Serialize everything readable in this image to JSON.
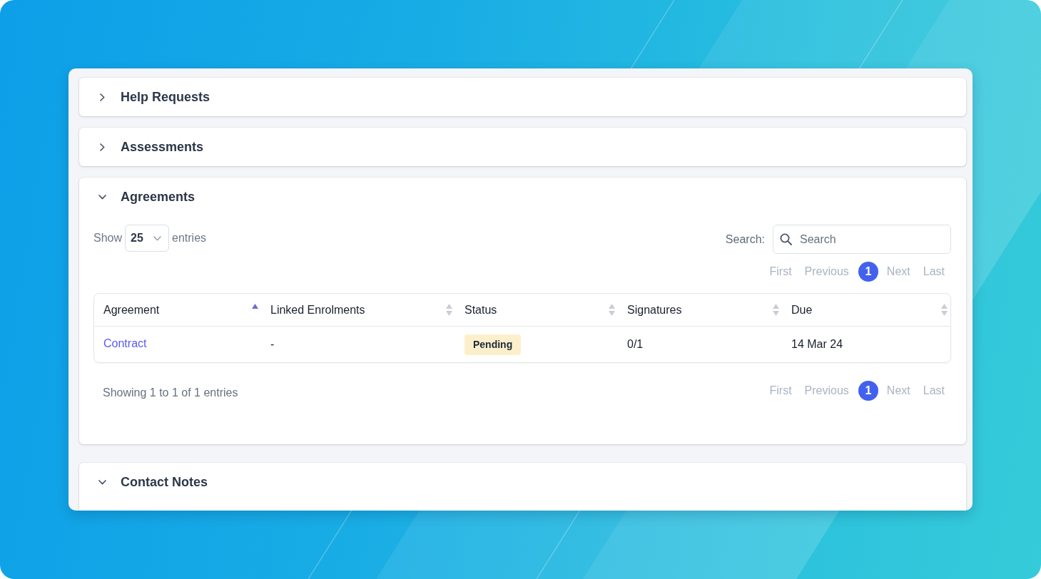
{
  "sections": [
    {
      "title": "Help Requests",
      "expanded": false
    },
    {
      "title": "Assessments",
      "expanded": false
    },
    {
      "title": "Agreements",
      "expanded": true,
      "table": {
        "length_menu": {
          "label": "Show",
          "value": "25",
          "suffix": "entries"
        },
        "search": {
          "label": "Search:",
          "placeholder": "Search"
        },
        "pagination_top": [
          {
            "label": "First",
            "selected": false,
            "disabled": true
          },
          {
            "label": "Previous",
            "selected": false,
            "disabled": true
          },
          {
            "label": "1",
            "selected": true,
            "disabled": false
          },
          {
            "label": "Next",
            "selected": false,
            "disabled": true
          },
          {
            "label": "Last",
            "selected": false,
            "disabled": true
          }
        ],
        "columns": [
          {
            "label": "Agreement",
            "sorted": true
          },
          {
            "label": "Linked Enrolments",
            "sorted": false
          },
          {
            "label": "Status",
            "sorted": false
          },
          {
            "label": "Signatures",
            "sorted": false
          },
          {
            "label": "Due",
            "sorted": false
          }
        ],
        "rows": [
          {
            "cells": [
              {
                "kind": "link",
                "text": "Contract"
              },
              {
                "kind": "text",
                "text": "-"
              },
              {
                "kind": "badge",
                "text": "Pending"
              },
              {
                "kind": "text",
                "text": "0/1"
              },
              {
                "kind": "text",
                "text": "14 Mar 24"
              }
            ]
          }
        ],
        "info": "Showing 1 to 1 of 1 entries",
        "pagination_bottom": [
          {
            "label": "First",
            "selected": false,
            "disabled": true
          },
          {
            "label": "Previous",
            "selected": false,
            "disabled": true
          },
          {
            "label": "1",
            "selected": true,
            "disabled": false
          },
          {
            "label": "Next",
            "selected": false,
            "disabled": true
          },
          {
            "label": "Last",
            "selected": false,
            "disabled": true
          }
        ]
      }
    },
    {
      "title": "Contact Notes",
      "expanded": true
    }
  ]
}
